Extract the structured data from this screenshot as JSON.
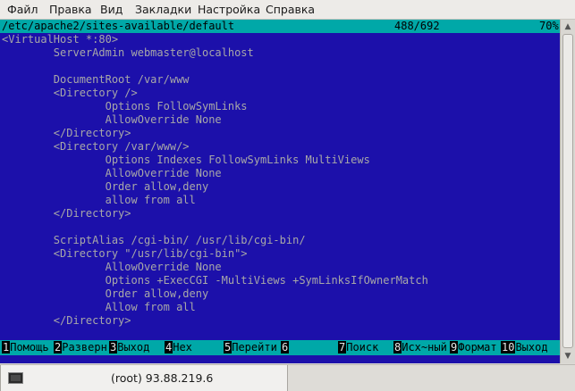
{
  "menubar": {
    "items": [
      "Файл",
      "Правка",
      "Вид",
      "Закладки",
      "Настройка",
      "Справка"
    ]
  },
  "editor": {
    "file_path": "/etc/apache2/sites-available/default",
    "line_position": "488/692",
    "percent": "70%",
    "lines": [
      "<VirtualHost *:80>",
      "        ServerAdmin webmaster@localhost",
      "",
      "        DocumentRoot /var/www",
      "        <Directory />",
      "                Options FollowSymLinks",
      "                AllowOverride None",
      "        </Directory>",
      "        <Directory /var/www/>",
      "                Options Indexes FollowSymLinks MultiViews",
      "                AllowOverride None",
      "                Order allow,deny",
      "                allow from all",
      "        </Directory>",
      "",
      "        ScriptAlias /cgi-bin/ /usr/lib/cgi-bin/",
      "        <Directory \"/usr/lib/cgi-bin\">",
      "                AllowOverride None",
      "                Options +ExecCGI -MultiViews +SymLinksIfOwnerMatch",
      "                Order allow,deny",
      "                Allow from all",
      "        </Directory>"
    ]
  },
  "function_keys": [
    {
      "num": "1",
      "label": "Помощь"
    },
    {
      "num": "2",
      "label": "Разверн"
    },
    {
      "num": "3",
      "label": "Выход"
    },
    {
      "num": "4",
      "label": "Hex"
    },
    {
      "num": "5",
      "label": "Перейти"
    },
    {
      "num": "6",
      "label": ""
    },
    {
      "num": "7",
      "label": "Поиск"
    },
    {
      "num": "8",
      "label": "Исх~ный"
    },
    {
      "num": "9",
      "label": "Формат"
    },
    {
      "num": "10",
      "label": "Выход"
    }
  ],
  "tab": {
    "icon": "terminal-icon",
    "title": "(root) 93.88.219.6"
  },
  "colors": {
    "editor_bg": "#1c10aa",
    "status_bg": "#00a8a8",
    "text": "#a8a8a8"
  }
}
